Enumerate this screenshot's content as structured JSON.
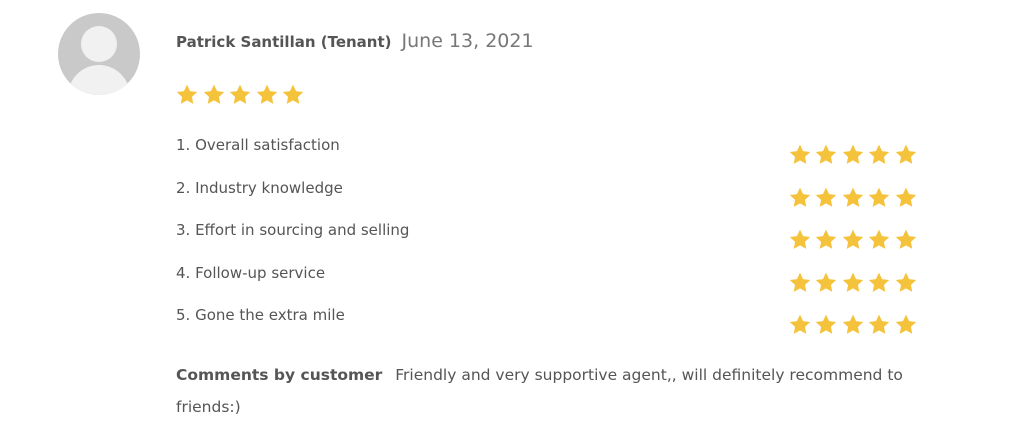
{
  "review": {
    "reviewer_name": "Patrick Santillan (Tenant)",
    "date": "June 13, 2021",
    "overall_rating": 5,
    "max_rating": 5,
    "star_color": "#F5C33B",
    "criteria": [
      {
        "label": "1. Overall satisfaction",
        "rating": 5
      },
      {
        "label": "2. Industry knowledge",
        "rating": 5
      },
      {
        "label": "3. Effort in sourcing and selling",
        "rating": 5
      },
      {
        "label": "4. Follow-up service",
        "rating": 5
      },
      {
        "label": "5. Gone the extra mile",
        "rating": 5
      }
    ],
    "comment_label": "Comments by customer",
    "comment_text": "Friendly and very supportive agent,, will definitely recommend to friends:)"
  }
}
